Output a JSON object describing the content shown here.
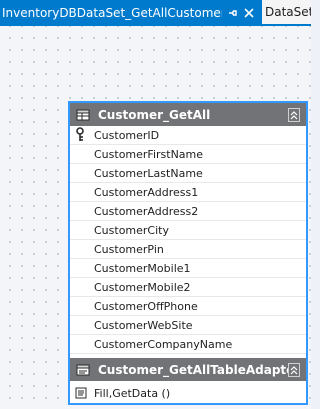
{
  "tabs": {
    "active_title": "InventoryDBDataSet_GetAllCustomer.xsd",
    "inactive_title": "DataSet_C"
  },
  "icons": {
    "pin": "pin-icon",
    "close": "close-icon",
    "table": "table-icon",
    "collapse": "collapse-icon",
    "primary_key": "key-icon",
    "adapter": "adapter-icon",
    "method": "method-icon"
  },
  "table": {
    "title": "Customer_GetAll",
    "columns": [
      "CustomerID",
      "CustomerFirstName",
      "CustomerLastName",
      "CustomerAddress1",
      "CustomerAddress2",
      "CustomerCity",
      "CustomerPin",
      "CustomerMobile1",
      "CustomerMobile2",
      "CustomerOffPhone",
      "CustomerWebSite",
      "CustomerCompanyName"
    ],
    "primary_key_column": "CustomerID"
  },
  "adapter": {
    "title": "Customer_GetAllTableAdapter",
    "method": "Fill,GetData ()"
  },
  "colors": {
    "accent": "#007acc",
    "selection_border": "#3399ff",
    "header_gray": "#727376"
  }
}
